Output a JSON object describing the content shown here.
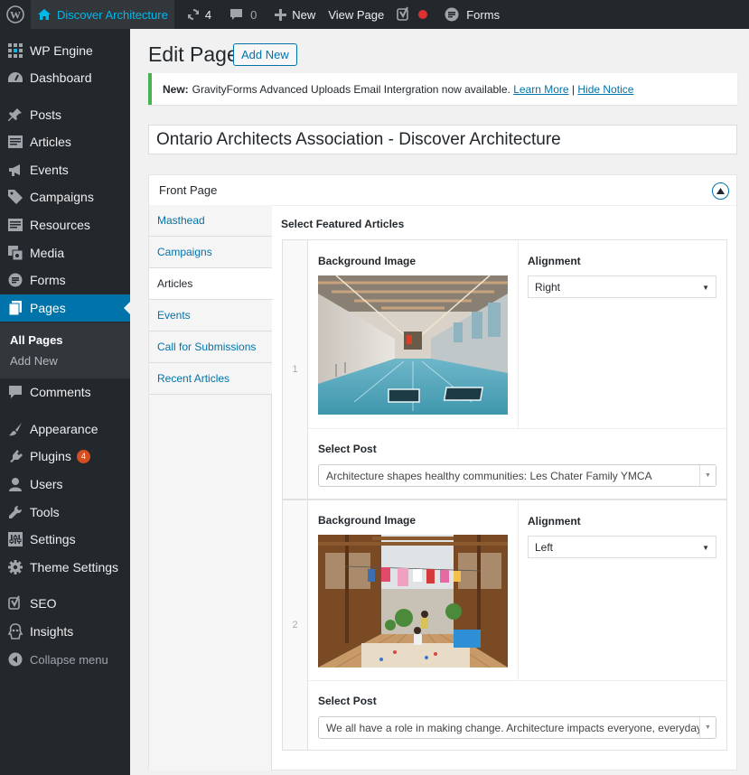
{
  "adminbar": {
    "site_name": "Discover Architecture",
    "updates_count": "4",
    "comments_count": "0",
    "new_label": "New",
    "view_page_label": "View Page",
    "forms_label": "Forms"
  },
  "sidebar": {
    "items": [
      {
        "label": "WP Engine",
        "icon": "wpengine-icon"
      },
      {
        "label": "Dashboard",
        "icon": "dashboard-icon"
      },
      {
        "label": "Posts",
        "icon": "pin-icon"
      },
      {
        "label": "Articles",
        "icon": "article-icon"
      },
      {
        "label": "Events",
        "icon": "megaphone-icon"
      },
      {
        "label": "Campaigns",
        "icon": "tag-icon"
      },
      {
        "label": "Resources",
        "icon": "article-icon"
      },
      {
        "label": "Media",
        "icon": "media-icon"
      },
      {
        "label": "Forms",
        "icon": "forms-icon"
      },
      {
        "label": "Pages",
        "icon": "pages-icon"
      },
      {
        "label": "Comments",
        "icon": "comment-icon"
      },
      {
        "label": "Appearance",
        "icon": "brush-icon"
      },
      {
        "label": "Plugins",
        "icon": "plugin-icon",
        "badge": "4"
      },
      {
        "label": "Users",
        "icon": "user-icon"
      },
      {
        "label": "Tools",
        "icon": "wrench-icon"
      },
      {
        "label": "Settings",
        "icon": "settings-icon"
      },
      {
        "label": "Theme Settings",
        "icon": "gear-icon"
      },
      {
        "label": "SEO",
        "icon": "yoast-icon"
      },
      {
        "label": "Insights",
        "icon": "insights-icon"
      }
    ],
    "submenu": {
      "all_pages": "All Pages",
      "add_new": "Add New"
    },
    "collapse_label": "Collapse menu"
  },
  "header": {
    "title": "Edit Page",
    "add_new_label": "Add New"
  },
  "notice": {
    "prefix": "New:",
    "message": "GravityForms Advanced Uploads Email Intergration now available.",
    "learn_more": "Learn More",
    "separator": "|",
    "hide": "Hide Notice"
  },
  "post_title": "Ontario Architects Association - Discover Architecture",
  "metabox": {
    "title": "Front Page",
    "tabs": [
      "Masthead",
      "Campaigns",
      "Articles",
      "Events",
      "Call for Submissions",
      "Recent Articles"
    ],
    "active_tab": "Articles",
    "field_label": "Select Featured Articles",
    "rows": [
      {
        "number": "1",
        "bg_label": "Background Image",
        "alignment_label": "Alignment",
        "alignment_value": "Right",
        "post_label": "Select Post",
        "post_value": "Architecture shapes healthy communities: Les Chater Family YMCA"
      },
      {
        "number": "2",
        "bg_label": "Background Image",
        "alignment_label": "Alignment",
        "alignment_value": "Left",
        "post_label": "Select Post",
        "post_value": "We all have a role in making change. Architecture impacts everyone, everyday."
      }
    ]
  },
  "colors": {
    "accent": "#0073aa",
    "sidebar_bg": "#23282d",
    "notice_border": "#46b450",
    "badge": "#d54e21"
  }
}
